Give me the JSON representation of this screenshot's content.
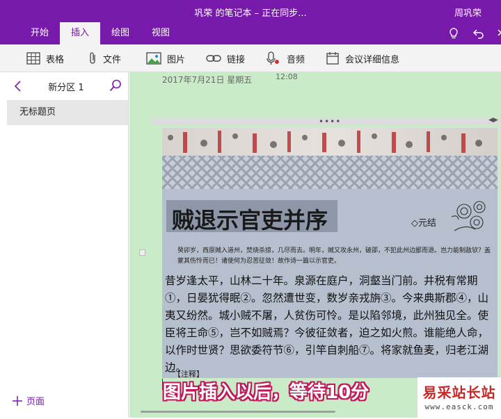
{
  "window": {
    "title": "巩荣 的笔记本 – 正在同步...",
    "user": "周巩荣"
  },
  "tabs": [
    {
      "label": "开始"
    },
    {
      "label": "插入"
    },
    {
      "label": "绘图"
    },
    {
      "label": "视图"
    }
  ],
  "tab_icons": [
    "lightbulb-icon",
    "undo-icon"
  ],
  "ribbon": {
    "table": "表格",
    "file": "文件",
    "picture": "图片",
    "link": "链接",
    "audio": "音频",
    "meeting": "会议详细信息"
  },
  "left_pane": {
    "section_name": "新分区 1",
    "pages": [
      "无标题页"
    ],
    "add_page": "页面"
  },
  "page": {
    "date": "2017年7月21日 星期五",
    "time": "12:08"
  },
  "photo": {
    "headline": "贼退示官吏并序",
    "author": "◇元结",
    "lead": "癸卯岁，西原贼入道州，焚烧杀掠，几尽而去。明年，贼又攻永州，破邵，不犯此州边鄙而退。岂力能制敌欤？盖蒙其伤怜而已！诸使何为忍苦征敛！故作诗一篇以示官吏。",
    "body": "昔岁逢太平，山林二十年。泉源在庭户，洞壑当门前。井税有常期①，日晏犹得眠②。忽然遭世变，数岁亲戎旃③。今来典斯郡④，山夷又纷然。城小贼不屠，人贫伤可怜。是以陷邻境，此州独见全。使臣将王命⑤，岂不如贼焉？今彼征敛者，迫之如火煎。谁能绝人命，以作时世贤？思欲委符节⑥，引竿自刺船⑦。将家就鱼麦，归老江湖边。",
    "note": "【注释】"
  },
  "caption": "图片插入以后，等待10分",
  "watermark": {
    "main": "易采站长站",
    "sub": "www.easck.com"
  },
  "colors": {
    "brand": "#7719aa",
    "canvas": "#c9ebc7",
    "caption_outline": "#c2185b"
  }
}
